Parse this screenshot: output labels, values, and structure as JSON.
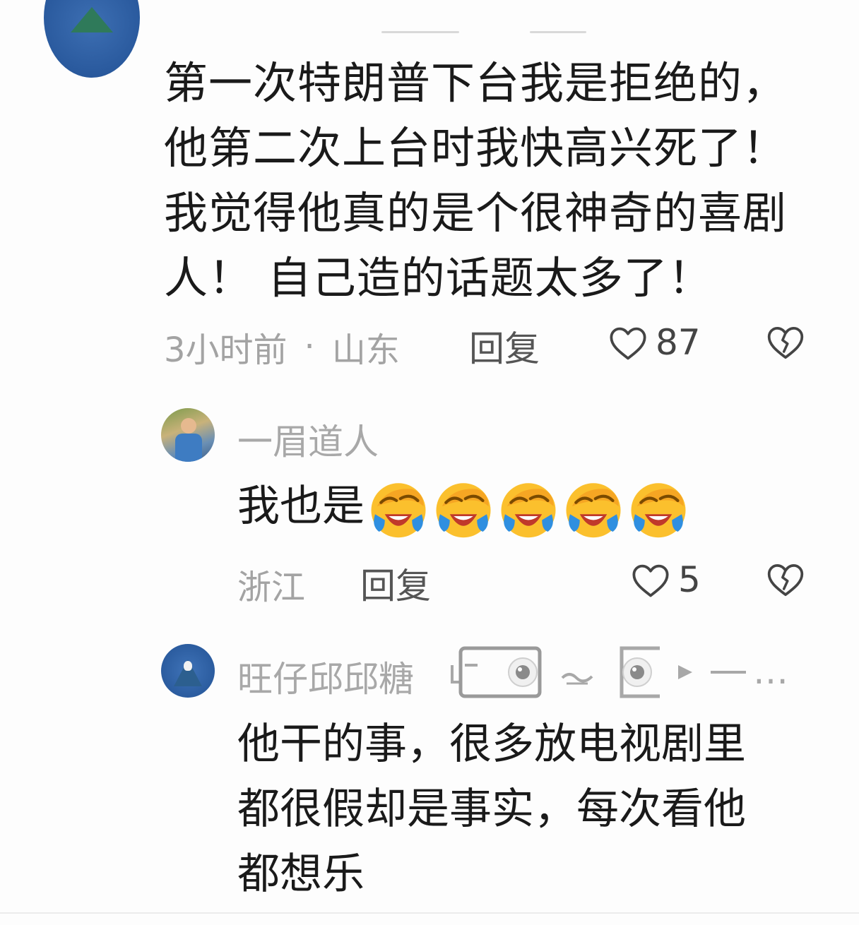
{
  "main_comment": {
    "text_lines": [
      "第一次特朗普下台我是拒绝的，",
      "他第二次上台时我快高兴死了！",
      "我觉得他真的是个很神奇的喜剧",
      "人！ 自己造的话题太多了！"
    ],
    "time": "3小时前",
    "separator": "·",
    "location": "山东",
    "reply_label": "回复",
    "like_count": "87"
  },
  "replies": [
    {
      "username": "一眉道人",
      "text": "我也是",
      "emoji_count": 5,
      "location": "浙江",
      "reply_label": "回复",
      "like_count": "5"
    },
    {
      "username": "旺仔邱邱糖",
      "username_suffix": "…",
      "text_lines": [
        "他干的事，很多放电视剧里",
        "都很假却是事实，每次看他",
        "都想乐"
      ]
    }
  ],
  "icons": {
    "like": "heart-outline-icon",
    "dislike": "broken-heart-icon",
    "emoji": "crying-laughing-emoji"
  },
  "colors": {
    "text_primary": "#1a1a1a",
    "text_secondary": "#a3a3a3",
    "emoji_yellow": "#fbc02d",
    "emoji_blue": "#2f8fe0"
  }
}
